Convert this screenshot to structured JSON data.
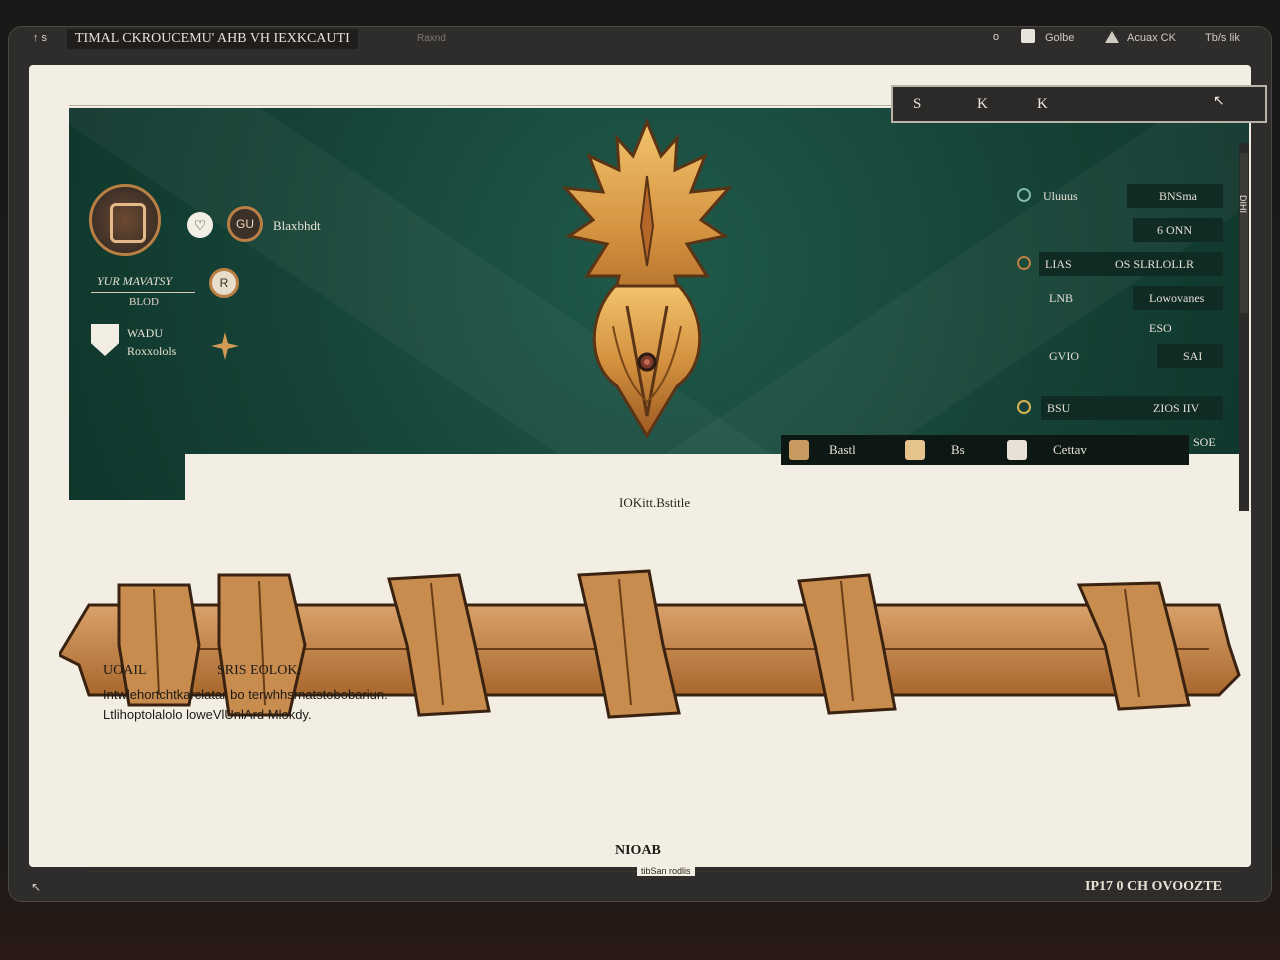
{
  "titlebar": {
    "controls": "↑ s",
    "title": "TIMAL CKROUCEMU' AHB VH IEXKCAUTI",
    "subtitle": "Raxnd",
    "right_dot": "o",
    "right_a": "Golbe",
    "right_b": "Acuax CK",
    "right_c": "Tb/s lik"
  },
  "dropdown": {
    "options": [
      "S",
      "K",
      "K"
    ],
    "caret": "↖"
  },
  "left_panel": {
    "heart": "♡",
    "ring_label": "GU",
    "name": "Blaxbhdt",
    "role": "YUR MAVATSY",
    "subrole": "BLOD",
    "badge": "R",
    "level_a": "WADU",
    "level_b": "Roxxolols"
  },
  "stats": [
    {
      "a": "Uluuus",
      "b": "BNSma"
    },
    {
      "a": "",
      "b": "6 ONN"
    },
    {
      "a": "LIAS",
      "b": "OS SLRLOLLR"
    },
    {
      "a": "LNB",
      "b": "Lowovanes"
    },
    {
      "a": "",
      "b": "ESO"
    },
    {
      "a": "GVIO",
      "b": "SAI"
    },
    {
      "a": "BSU",
      "b": "ZIOS  IIV"
    },
    {
      "a": "",
      "b": "SOE"
    }
  ],
  "scroll_label": "DIHI",
  "action_bar": {
    "items": [
      "Bastl",
      "Bs",
      "Cettav"
    ]
  },
  "stage_label": "IOKitt.Bstitle",
  "description": {
    "heading_a": "UOAIL",
    "heading_b": "SRIS EOLOK:",
    "line1": "Intwlehortchtkarclatar bo terwhhsrnatstobobariun.",
    "line2": "Ltlihoptolalolo loweVlUnlArd Mlokdy."
  },
  "footer": {
    "title": "NIOAB",
    "subtitle": "tibSan rodlis"
  },
  "statusbar": {
    "left": "↖",
    "right": "IP17 0 CH OVOOZTE"
  },
  "colors": {
    "banner": "#164438",
    "paper": "#f3eee3",
    "gold": "#c79a5f",
    "ribbon": "#c98c4f"
  }
}
